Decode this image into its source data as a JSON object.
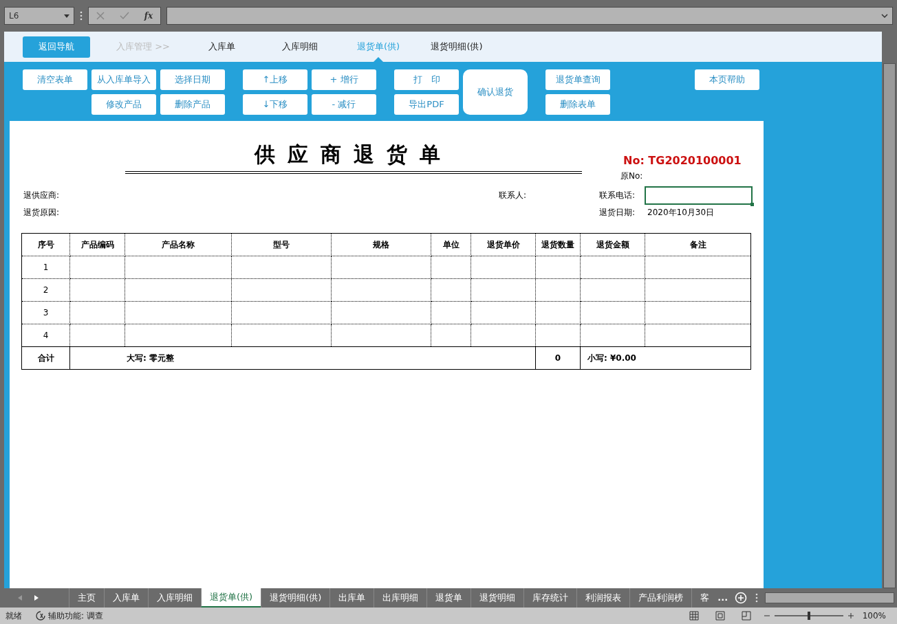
{
  "formula_bar": {
    "name_box": "L6",
    "function_label": "fx"
  },
  "nav": [
    {
      "label": "返回导航",
      "kind": "button",
      "selected": false
    },
    {
      "label": "入库管理 >>",
      "kind": "crumb",
      "selected": false
    },
    {
      "label": "入库单",
      "kind": "tab",
      "selected": false
    },
    {
      "label": "入库明细",
      "kind": "tab",
      "selected": false
    },
    {
      "label": "退货单(供)",
      "kind": "tab",
      "selected": true
    },
    {
      "label": "退货明细(供)",
      "kind": "tab",
      "selected": false
    }
  ],
  "toolbar": [
    [
      [
        "清空表单"
      ],
      [
        "从入库单导入",
        "修改产品"
      ],
      [
        "选择日期",
        "删除产品"
      ]
    ],
    [
      [
        "↑上移",
        "↓下移"
      ],
      [
        "+ 增行",
        "- 减行"
      ]
    ],
    [
      [
        "打　印",
        "导出PDF"
      ],
      [
        "确认退货"
      ]
    ],
    [
      [
        "退货单查询",
        "删除表单"
      ]
    ],
    [
      [
        "本页帮助"
      ]
    ]
  ],
  "form": {
    "title": "供应商退货单",
    "number": "No: TG2020100001",
    "original_number_label": "原No:",
    "fields_left": [
      "退供应商:",
      "退货原因:"
    ],
    "contact_label": "联系人:",
    "phone_label": "联系电话:",
    "date_label": "退货日期:",
    "date_value": "2020年10月30日"
  },
  "table": {
    "columns": [
      "序号",
      "产品编码",
      "产品名称",
      "型号",
      "规格",
      "单位",
      "退货单价",
      "退货数量",
      "退货金额",
      "备注"
    ],
    "rows": [
      [
        "1"
      ],
      [
        "2"
      ],
      [
        "3"
      ],
      [
        "4"
      ]
    ],
    "total": {
      "label": "合计",
      "amount_words": "大写: 零元整",
      "quantity": "0",
      "amount": "小写: ¥0.00"
    }
  },
  "sheet_tabs": [
    {
      "label": "主页",
      "selected": false
    },
    {
      "label": "入库单",
      "selected": false
    },
    {
      "label": "入库明细",
      "selected": false
    },
    {
      "label": "退货单(供)",
      "selected": true
    },
    {
      "label": "退货明细(供)",
      "selected": false
    },
    {
      "label": "出库单",
      "selected": false
    },
    {
      "label": "出库明细",
      "selected": false
    },
    {
      "label": "退货单",
      "selected": false
    },
    {
      "label": "退货明细",
      "selected": false
    },
    {
      "label": "库存统计",
      "selected": false
    },
    {
      "label": "利润报表",
      "selected": false
    },
    {
      "label": "产品利润榜",
      "selected": false
    },
    {
      "label": "客",
      "selected": false
    }
  ],
  "sheet_tabs_more": "...",
  "status_bar": {
    "ready": "就绪",
    "accessibility": "辅助功能: 调查",
    "zoom": "100%",
    "zoom_slider": {
      "level": 0.5
    }
  }
}
